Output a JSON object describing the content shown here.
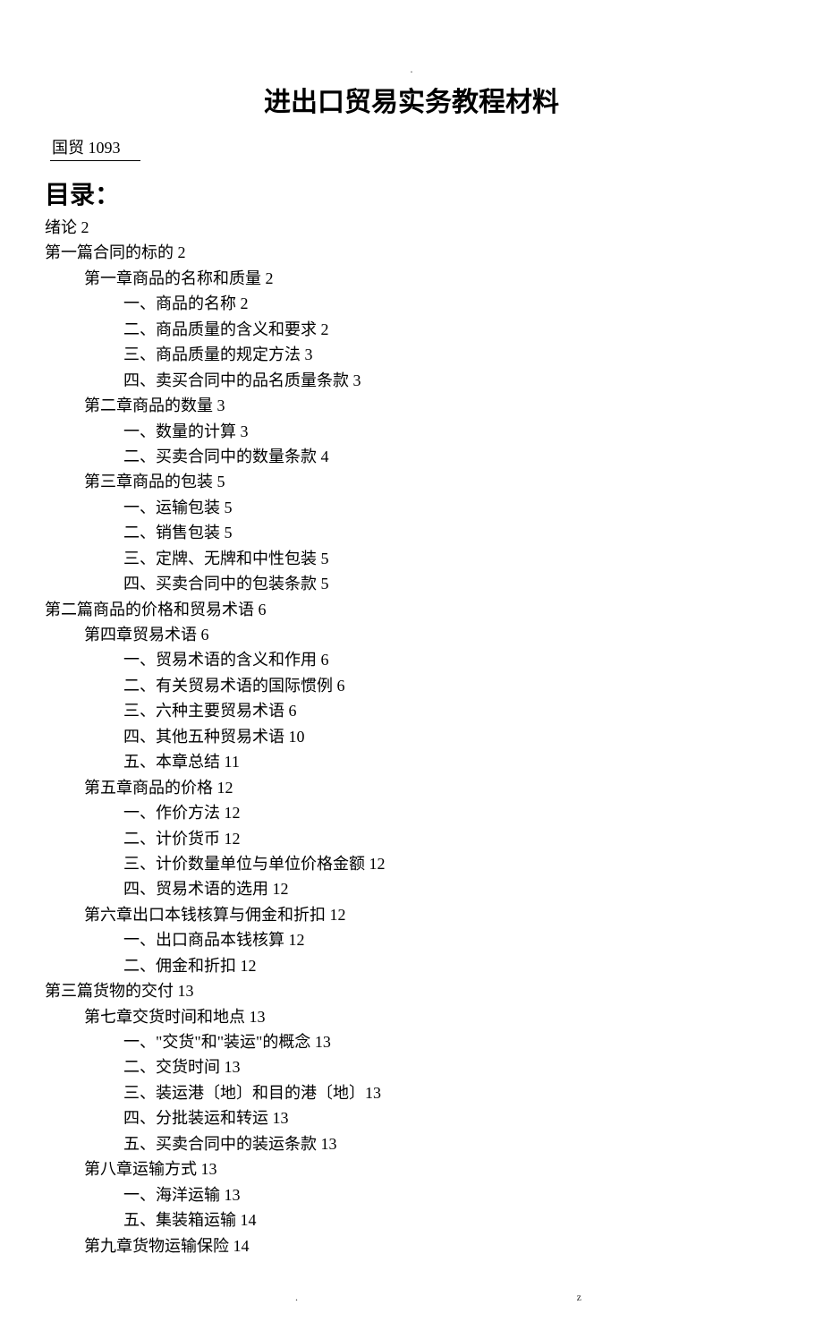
{
  "header_mark": ".",
  "title": "进出口贸易实务教程材料",
  "class_code": "国贸 1093",
  "toc_heading": "目录：",
  "footer_left": ".",
  "footer_right": "z",
  "toc": [
    {
      "level": 0,
      "text": "绪论 2"
    },
    {
      "level": 0,
      "text": "第一篇合同的标的 2"
    },
    {
      "level": 1,
      "text": "第一章商品的名称和质量 2"
    },
    {
      "level": 2,
      "text": "一、商品的名称 2"
    },
    {
      "level": 2,
      "text": "二、商品质量的含义和要求 2"
    },
    {
      "level": 2,
      "text": "三、商品质量的规定方法 3"
    },
    {
      "level": 2,
      "text": "四、卖买合同中的品名质量条款 3"
    },
    {
      "level": 1,
      "text": "第二章商品的数量 3"
    },
    {
      "level": 2,
      "text": "一、数量的计算 3"
    },
    {
      "level": 2,
      "text": "二、买卖合同中的数量条款 4"
    },
    {
      "level": 1,
      "text": "第三章商品的包装 5"
    },
    {
      "level": 2,
      "text": "一、运输包装 5"
    },
    {
      "level": 2,
      "text": "二、销售包装 5"
    },
    {
      "level": 2,
      "text": "三、定牌、无牌和中性包装 5"
    },
    {
      "level": 2,
      "text": "四、买卖合同中的包装条款 5"
    },
    {
      "level": 0,
      "text": "第二篇商品的价格和贸易术语 6"
    },
    {
      "level": 1,
      "text": "第四章贸易术语 6"
    },
    {
      "level": 2,
      "text": "一、贸易术语的含义和作用 6"
    },
    {
      "level": 2,
      "text": "二、有关贸易术语的国际惯例 6"
    },
    {
      "level": 2,
      "text": "三、六种主要贸易术语 6"
    },
    {
      "level": 2,
      "text": "四、其他五种贸易术语 10"
    },
    {
      "level": 2,
      "text": "五、本章总结 11"
    },
    {
      "level": 1,
      "text": "第五章商品的价格 12"
    },
    {
      "level": 2,
      "text": "一、作价方法 12"
    },
    {
      "level": 2,
      "text": "二、计价货币 12"
    },
    {
      "level": 2,
      "text": "三、计价数量单位与单位价格金额 12"
    },
    {
      "level": 2,
      "text": "四、贸易术语的选用 12"
    },
    {
      "level": 1,
      "text": "第六章出口本钱核算与佣金和折扣 12"
    },
    {
      "level": 2,
      "text": "一、出口商品本钱核算 12"
    },
    {
      "level": 2,
      "text": "二、佣金和折扣 12"
    },
    {
      "level": 0,
      "text": "第三篇货物的交付 13"
    },
    {
      "level": 1,
      "text": "第七章交货时间和地点 13"
    },
    {
      "level": 2,
      "text": "一、\"交货\"和\"装运\"的概念 13"
    },
    {
      "level": 2,
      "text": "二、交货时间 13"
    },
    {
      "level": 2,
      "text": "三、装运港〔地〕和目的港〔地〕13"
    },
    {
      "level": 2,
      "text": "四、分批装运和转运 13"
    },
    {
      "level": 2,
      "text": "五、买卖合同中的装运条款 13"
    },
    {
      "level": 1,
      "text": "第八章运输方式 13"
    },
    {
      "level": 2,
      "text": "一、海洋运输 13"
    },
    {
      "level": 2,
      "text": "五、集装箱运输 14"
    },
    {
      "level": 1,
      "text": "第九章货物运输保险 14"
    }
  ]
}
